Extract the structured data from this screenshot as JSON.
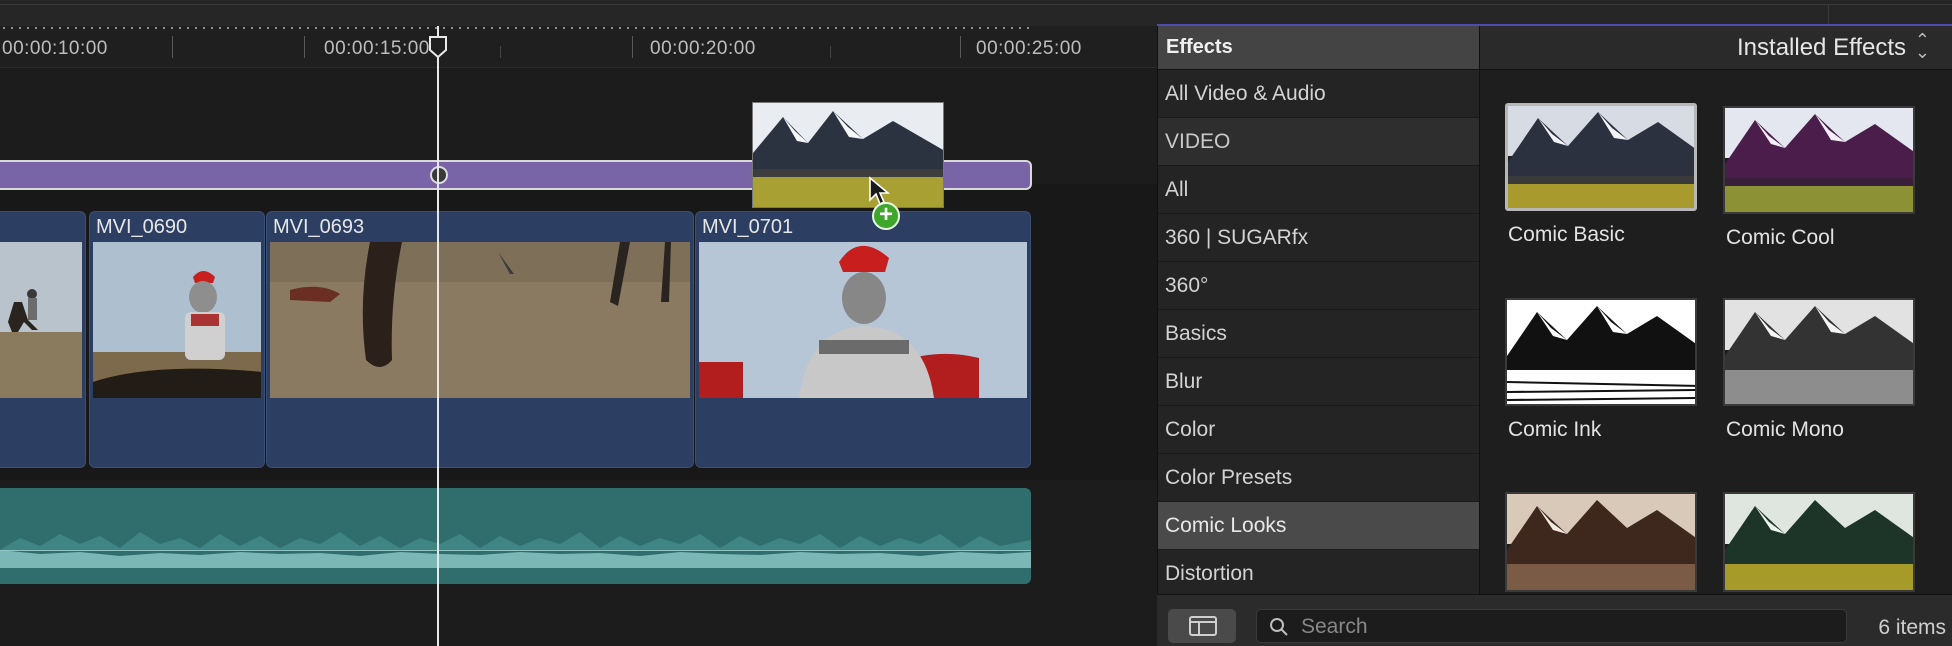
{
  "timeline": {
    "timecodes": [
      "00:00:10:00",
      "00:00:15:00",
      "00:00:20:00",
      "00:00:25:00"
    ],
    "clips": [
      {
        "name": ""
      },
      {
        "name": "MVI_0690"
      },
      {
        "name": "MVI_0693"
      },
      {
        "name": "MVI_0701"
      }
    ]
  },
  "effects_sidebar": {
    "header": "Effects",
    "items": [
      {
        "label": "All Video & Audio"
      },
      {
        "label": "VIDEO"
      },
      {
        "label": "All"
      },
      {
        "label": "360 | SUGARfx"
      },
      {
        "label": "360°"
      },
      {
        "label": "Basics"
      },
      {
        "label": "Blur"
      },
      {
        "label": "Color"
      },
      {
        "label": "Color Presets"
      },
      {
        "label": "Comic Looks"
      },
      {
        "label": "Distortion"
      }
    ],
    "selected": "Comic Looks"
  },
  "effects_browser": {
    "filter_label": "Installed Effects",
    "tiles": [
      {
        "label": "Comic Basic"
      },
      {
        "label": "Comic Cool"
      },
      {
        "label": "Comic Ink"
      },
      {
        "label": "Comic Mono"
      },
      {
        "label": ""
      },
      {
        "label": ""
      }
    ]
  },
  "bottom_bar": {
    "search_placeholder": "Search",
    "item_count": "6 items"
  },
  "colors": {
    "accent_line": "#4d4bb0",
    "adjustment_clip": "#7a64a8",
    "video_clip": "#2c3f62",
    "audio_clip": "#2f6e6d",
    "add_badge": "#3fa62c"
  },
  "icons": [
    "playhead-icon",
    "keyframe-icon",
    "pointer-cursor-icon",
    "add-plus-icon",
    "sidebar-toggle-icon",
    "search-icon",
    "sort-arrows-icon"
  ]
}
